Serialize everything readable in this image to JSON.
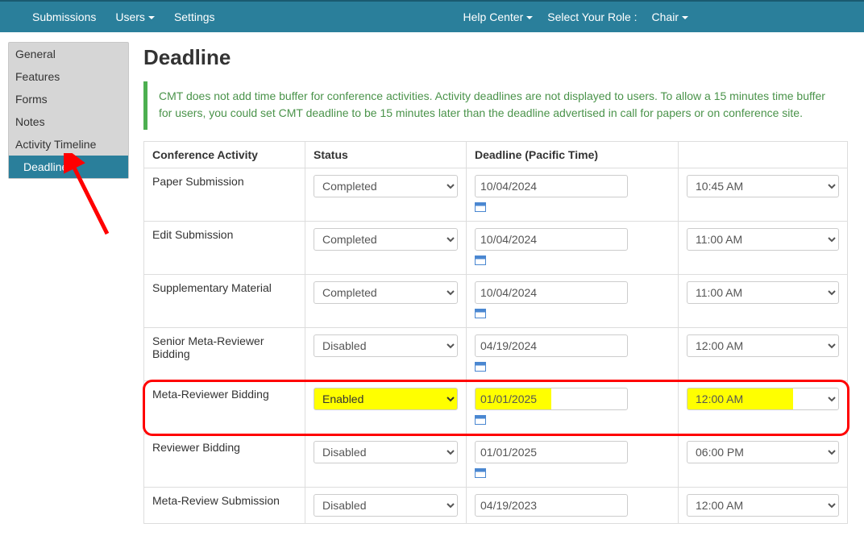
{
  "nav": {
    "submissions": "Submissions",
    "users": "Users",
    "settings": "Settings",
    "help": "Help Center",
    "role_label": "Select Your Role :",
    "role_value": "Chair"
  },
  "sidebar": {
    "items": [
      {
        "label": "General"
      },
      {
        "label": "Features"
      },
      {
        "label": "Forms"
      },
      {
        "label": "Notes"
      },
      {
        "label": "Activity Timeline"
      },
      {
        "label": "Deadline"
      }
    ]
  },
  "page": {
    "title": "Deadline",
    "alert": "CMT does not add time buffer for conference activities. Activity deadlines are not displayed to users. To allow a 15 minutes time buffer for users, you could set CMT deadline to be 15 minutes later than the deadline advertised in call for papers or on conference site."
  },
  "table": {
    "headers": {
      "activity": "Conference Activity",
      "status": "Status",
      "deadline": "Deadline (Pacific Time)"
    },
    "rows": [
      {
        "activity": "Paper Submission",
        "status": "Completed",
        "date": "10/04/2024",
        "time": "10:45 AM"
      },
      {
        "activity": "Edit Submission",
        "status": "Completed",
        "date": "10/04/2024",
        "time": "11:00 AM"
      },
      {
        "activity": "Supplementary Material",
        "status": "Completed",
        "date": "10/04/2024",
        "time": "11:00 AM"
      },
      {
        "activity": "Senior Meta-Reviewer Bidding",
        "status": "Disabled",
        "date": "04/19/2024",
        "time": "12:00 AM"
      },
      {
        "activity": "Meta-Reviewer Bidding",
        "status": "Enabled",
        "date": "01/01/2025",
        "time": "12:00 AM"
      },
      {
        "activity": "Reviewer Bidding",
        "status": "Disabled",
        "date": "01/01/2025",
        "time": "06:00 PM"
      },
      {
        "activity": "Meta-Review Submission",
        "status": "Disabled",
        "date": "04/19/2023",
        "time": "12:00 AM"
      }
    ]
  }
}
